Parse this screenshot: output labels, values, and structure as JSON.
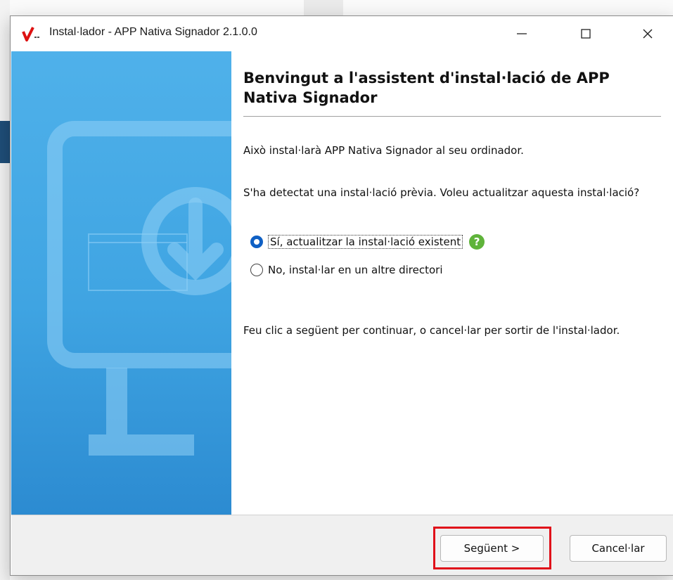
{
  "window": {
    "title": "Instal·lador - APP Nativa Signador 2.1.0.0",
    "controls": {
      "minimize": "—",
      "maximize": "☐",
      "close": "✕"
    }
  },
  "page": {
    "heading": "Benvingut a l'assistent d'instal·lació de APP Nativa Signador",
    "intro": "Això instal·larà APP Nativa Signador al seu ordinador.",
    "question": "S'ha detectat una instal·lació prèvia. Voleu actualitzar aquesta instal·lació?",
    "options": [
      {
        "label": "Sí, actualitzar la instal·lació existent",
        "selected": true
      },
      {
        "label": "No, instal·lar en un altre directori",
        "selected": false
      }
    ],
    "help_icon": "?",
    "instructions": "Feu clic a següent per continuar, o cancel·lar per sortir de l'instal·lador."
  },
  "footer": {
    "next_label": "Següent >",
    "cancel_label": "Cancel·lar"
  },
  "colors": {
    "sidebar_blue": "#3fa4e2",
    "radio_selected": "#0f60c4",
    "help_green": "#5fb33a",
    "highlight_red": "#e0101a"
  },
  "icons": [
    "app-logo-icon",
    "minimize-icon",
    "maximize-icon",
    "close-icon",
    "monitor-download-icon",
    "help-icon"
  ]
}
